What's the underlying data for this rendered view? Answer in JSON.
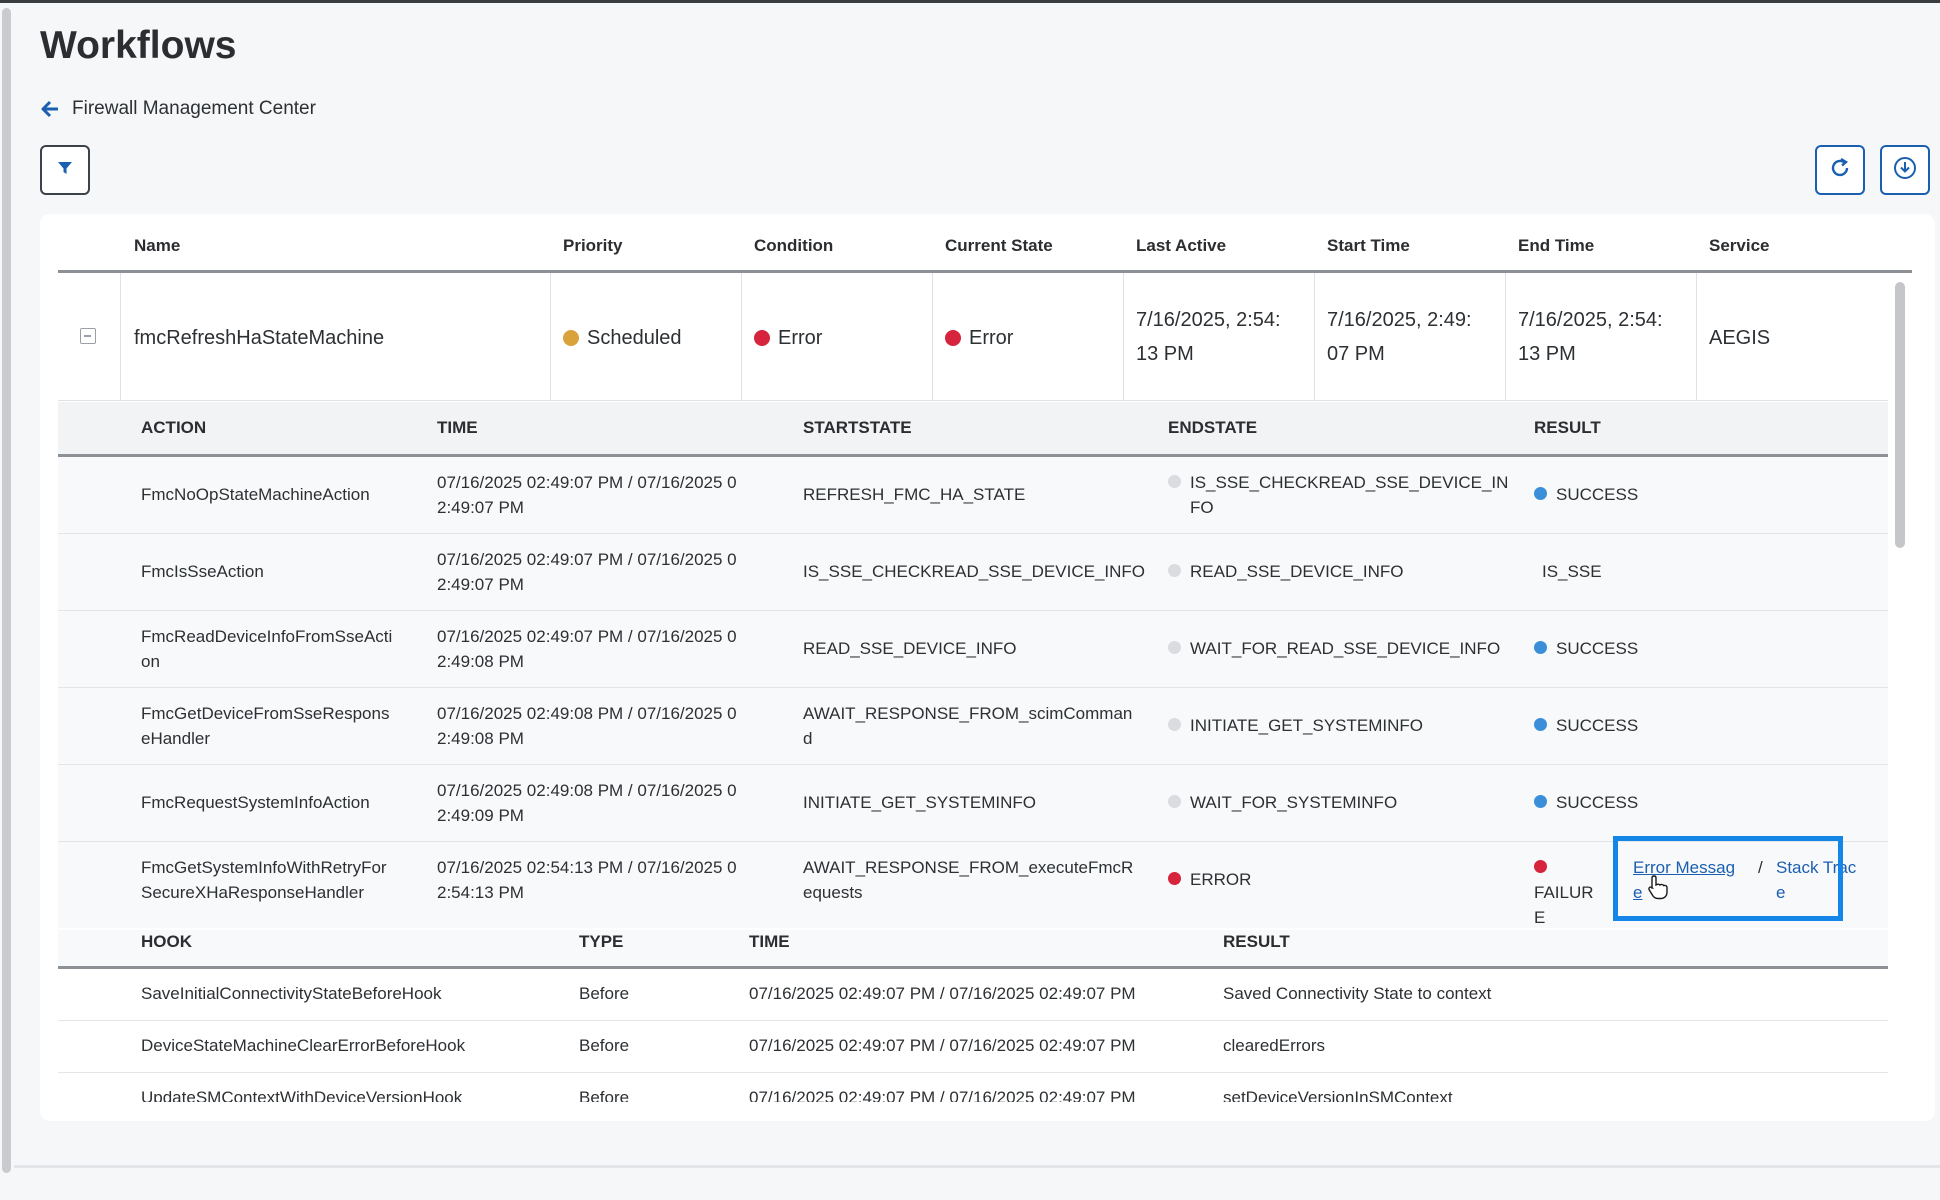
{
  "page": {
    "title": "Workflows",
    "breadcrumb": "Firewall Management Center"
  },
  "toolbar": {
    "filter_icon": "filter-icon",
    "refresh_icon": "refresh-icon",
    "download_icon": "download-icon"
  },
  "columns": [
    "Name",
    "Priority",
    "Condition",
    "Current State",
    "Last Active",
    "Start Time",
    "End Time",
    "Service"
  ],
  "workflow": {
    "name": "fmcRefreshHaStateMachine",
    "priority": "Scheduled",
    "condition": "Error",
    "current_state": "Error",
    "last_active": [
      "7/16/2025, 2:54:",
      "13 PM"
    ],
    "start_time": [
      "7/16/2025, 2:49:",
      "07 PM"
    ],
    "end_time": [
      "7/16/2025, 2:54:",
      "13 PM"
    ],
    "service": "AEGIS",
    "colors": {
      "scheduled": "#d9a23a",
      "error": "#d6243c"
    }
  },
  "actions_columns": [
    "ACTION",
    "TIME",
    "STARTSTATE",
    "ENDSTATE",
    "RESULT"
  ],
  "actions": [
    {
      "action": [
        "FmcNoOpStateMachineAction"
      ],
      "time": [
        "07/16/2025 02:49:07 PM / 07/16/2025 0",
        "2:49:07 PM"
      ],
      "start": [
        "REFRESH_FMC_HA_STATE"
      ],
      "end": [
        "IS_SSE_CHECKREAD_SSE_DEVICE_IN",
        "FO"
      ],
      "result": "SUCCESS"
    },
    {
      "action": [
        "FmcIsSseAction"
      ],
      "time": [
        "07/16/2025 02:49:07 PM / 07/16/2025 0",
        "2:49:07 PM"
      ],
      "start": [
        "IS_SSE_CHECKREAD_SSE_DEVICE_INFO"
      ],
      "end": [
        "READ_SSE_DEVICE_INFO"
      ],
      "result": "IS_SSE"
    },
    {
      "action": [
        "FmcReadDeviceInfoFromSseActi",
        "on"
      ],
      "time": [
        "07/16/2025 02:49:07 PM / 07/16/2025 0",
        "2:49:08 PM"
      ],
      "start": [
        "READ_SSE_DEVICE_INFO"
      ],
      "end": [
        "WAIT_FOR_READ_SSE_DEVICE_INFO"
      ],
      "result": "SUCCESS"
    },
    {
      "action": [
        "FmcGetDeviceFromSseRespons",
        "eHandler"
      ],
      "time": [
        "07/16/2025 02:49:08 PM / 07/16/2025 0",
        "2:49:08 PM"
      ],
      "start": [
        "AWAIT_RESPONSE_FROM_scimComman",
        "d"
      ],
      "end": [
        "INITIATE_GET_SYSTEMINFO"
      ],
      "result": "SUCCESS"
    },
    {
      "action": [
        "FmcRequestSystemInfoAction"
      ],
      "time": [
        "07/16/2025 02:49:08 PM / 07/16/2025 0",
        "2:49:09 PM"
      ],
      "start": [
        "INITIATE_GET_SYSTEMINFO"
      ],
      "end": [
        "WAIT_FOR_SYSTEMINFO"
      ],
      "result": "SUCCESS"
    },
    {
      "action": [
        "FmcGetSystemInfoWithRetryFor",
        "SecureXHaResponseHandler"
      ],
      "time": [
        "07/16/2025 02:54:13 PM / 07/16/2025 0",
        "2:54:13 PM"
      ],
      "start": [
        "AWAIT_RESPONSE_FROM_executeFmcR",
        "equests"
      ],
      "end": [
        "ERROR"
      ],
      "result": "FAILUR E"
    }
  ],
  "failure_links": {
    "error_message": [
      "Error Messag",
      "e"
    ],
    "separator": "/",
    "stack_trace": [
      "Stack Trac",
      "e"
    ]
  },
  "hooks_columns": [
    "HOOK",
    "TYPE",
    "TIME",
    "RESULT"
  ],
  "hooks": [
    {
      "hook": "SaveInitialConnectivityStateBeforeHook",
      "type": "Before",
      "time": "07/16/2025 02:49:07 PM / 07/16/2025 02:49:07 PM",
      "result": "Saved Connectivity State to context"
    },
    {
      "hook": "DeviceStateMachineClearErrorBeforeHook",
      "type": "Before",
      "time": "07/16/2025 02:49:07 PM / 07/16/2025 02:49:07 PM",
      "result": "clearedErrors"
    },
    {
      "hook": "UpdateSMContextWithDeviceVersionHook",
      "type": "Before",
      "time": "07/16/2025 02:49:07 PM / 07/16/2025 02:49:07 PM",
      "result": "setDeviceVersionInSMContext"
    }
  ]
}
